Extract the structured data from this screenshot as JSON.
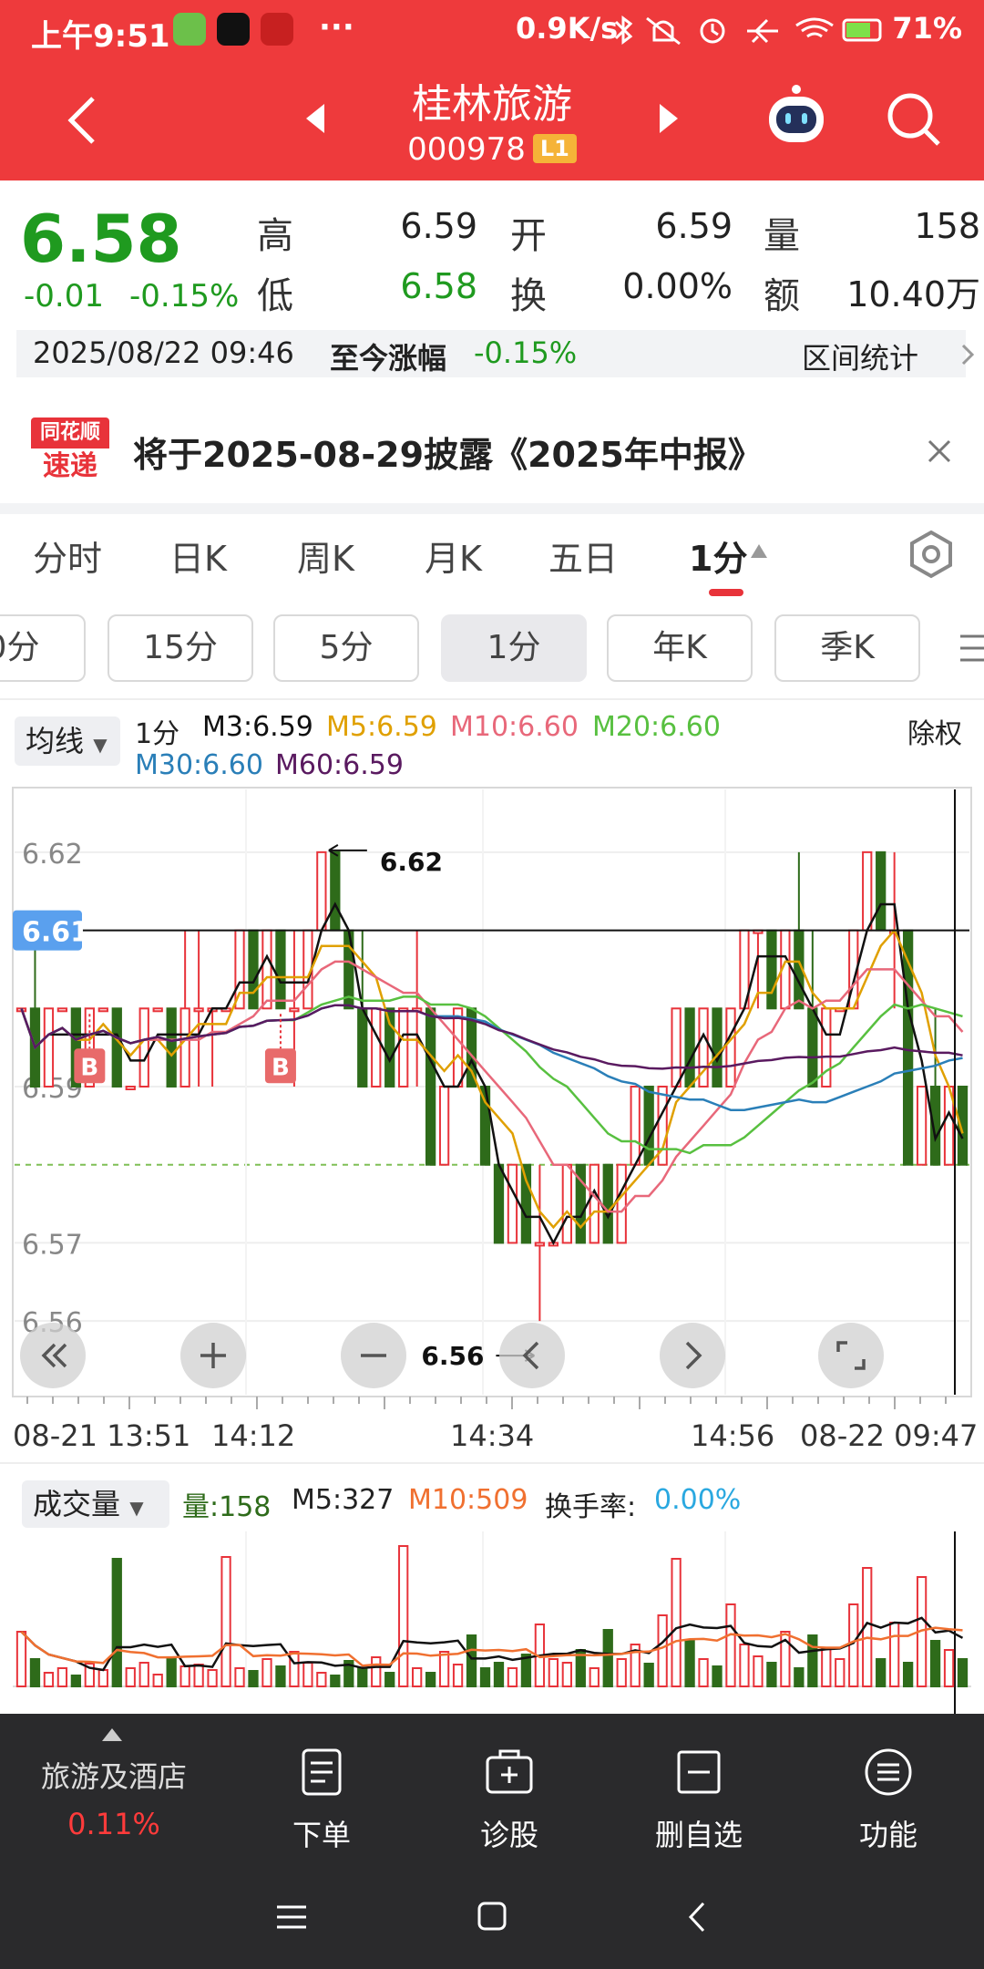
{
  "status": {
    "time": "上午9:51",
    "ellipsis": "···",
    "net_speed": "0.9K/s",
    "battery": "71%"
  },
  "nav": {
    "stock_name": "桂林旅游",
    "stock_code": "000978",
    "level_badge": "L1"
  },
  "quote": {
    "price": "6.58",
    "change": "-0.01",
    "change_pct": "-0.15%",
    "high_label": "高",
    "high": "6.59",
    "low_label": "低",
    "low": "6.58",
    "open_label": "开",
    "open": "6.59",
    "turnover_label": "换",
    "turnover": "0.00%",
    "volume_label": "量",
    "volume": "158",
    "amount_label": "额",
    "amount": "10.40万"
  },
  "datebar": {
    "datetime": "2025/08/22 09:46",
    "since_label": "至今涨幅",
    "since_value": "-0.15%",
    "interval_stats": "区间统计"
  },
  "notice": {
    "logo_top": "同花顺",
    "logo_bottom": "速递",
    "text": "将于2025-08-29披露《2025年中报》"
  },
  "period_tabs": [
    "分时",
    "日K",
    "周K",
    "月K",
    "五日",
    "1分"
  ],
  "period_pills": [
    "0分",
    "15分",
    "5分",
    "1分",
    "年K",
    "季K"
  ],
  "legend": {
    "ma_button": "均线",
    "period": "1分",
    "m3": "M3:6.59",
    "m5": "M5:6.59",
    "m10": "M10:6.60",
    "m20": "M20:6.60",
    "m30": "M30:6.60",
    "m60": "M60:6.59",
    "adjust": "除权"
  },
  "colors": {
    "header": "#ee3a3c",
    "up": "#e8333a",
    "down": "#2e6b1a",
    "m3": "#111111",
    "m5": "#e0a000",
    "m10": "#e8687a",
    "m20": "#58c040",
    "m30": "#2a7fb8",
    "m60": "#5a1a60"
  },
  "chart_data": {
    "type": "candlestick",
    "y_ticks": [
      "6.62",
      "6.61",
      "6.59",
      "6.57",
      "6.56"
    ],
    "ylim": [
      6.555,
      6.625
    ],
    "crosshair_value": "6.61",
    "max_label": "6.62",
    "min_label": "6.56",
    "buy_marker": "B",
    "x_ticks": [
      "08-21 13:51",
      "14:12",
      "14:34",
      "14:56",
      "08-22 09:47"
    ],
    "controls": [
      "first-icon",
      "plus-icon",
      "minus-icon",
      "prev-icon",
      "next-icon",
      "fullscreen-icon"
    ],
    "candles": [
      [
        6.6,
        6.6,
        6.6,
        6.6
      ],
      [
        6.6,
        6.61,
        6.59,
        6.59
      ],
      [
        6.59,
        6.6,
        6.59,
        6.6
      ],
      [
        6.6,
        6.6,
        6.6,
        6.6
      ],
      [
        6.6,
        6.6,
        6.59,
        6.59
      ],
      [
        6.59,
        6.6,
        6.59,
        6.6
      ],
      [
        6.6,
        6.6,
        6.6,
        6.6
      ],
      [
        6.6,
        6.6,
        6.59,
        6.59
      ],
      [
        6.59,
        6.59,
        6.59,
        6.59
      ],
      [
        6.59,
        6.6,
        6.59,
        6.6
      ],
      [
        6.6,
        6.6,
        6.6,
        6.6
      ],
      [
        6.6,
        6.6,
        6.59,
        6.59
      ],
      [
        6.59,
        6.61,
        6.59,
        6.6
      ],
      [
        6.6,
        6.61,
        6.59,
        6.6
      ],
      [
        6.6,
        6.6,
        6.59,
        6.6
      ],
      [
        6.6,
        6.6,
        6.6,
        6.6
      ],
      [
        6.6,
        6.61,
        6.6,
        6.61
      ],
      [
        6.61,
        6.61,
        6.6,
        6.6
      ],
      [
        6.6,
        6.61,
        6.6,
        6.61
      ],
      [
        6.61,
        6.61,
        6.6,
        6.6
      ],
      [
        6.6,
        6.61,
        6.59,
        6.6
      ],
      [
        6.6,
        6.61,
        6.6,
        6.61
      ],
      [
        6.61,
        6.62,
        6.61,
        6.62
      ],
      [
        6.62,
        6.62,
        6.61,
        6.61
      ],
      [
        6.61,
        6.61,
        6.6,
        6.6
      ],
      [
        6.6,
        6.61,
        6.59,
        6.59
      ],
      [
        6.59,
        6.6,
        6.59,
        6.6
      ],
      [
        6.6,
        6.6,
        6.59,
        6.59
      ],
      [
        6.59,
        6.6,
        6.59,
        6.6
      ],
      [
        6.6,
        6.61,
        6.59,
        6.6
      ],
      [
        6.6,
        6.6,
        6.58,
        6.58
      ],
      [
        6.58,
        6.59,
        6.58,
        6.59
      ],
      [
        6.59,
        6.6,
        6.59,
        6.6
      ],
      [
        6.6,
        6.6,
        6.59,
        6.59
      ],
      [
        6.59,
        6.59,
        6.58,
        6.58
      ],
      [
        6.58,
        6.58,
        6.57,
        6.57
      ],
      [
        6.57,
        6.58,
        6.57,
        6.58
      ],
      [
        6.58,
        6.58,
        6.57,
        6.57
      ],
      [
        6.57,
        6.58,
        6.56,
        6.57
      ],
      [
        6.57,
        6.57,
        6.57,
        6.57
      ],
      [
        6.57,
        6.58,
        6.57,
        6.58
      ],
      [
        6.58,
        6.58,
        6.57,
        6.57
      ],
      [
        6.57,
        6.58,
        6.57,
        6.58
      ],
      [
        6.58,
        6.58,
        6.57,
        6.57
      ],
      [
        6.57,
        6.58,
        6.57,
        6.58
      ],
      [
        6.58,
        6.59,
        6.58,
        6.59
      ],
      [
        6.59,
        6.59,
        6.58,
        6.58
      ],
      [
        6.58,
        6.59,
        6.58,
        6.59
      ],
      [
        6.59,
        6.6,
        6.59,
        6.6
      ],
      [
        6.6,
        6.6,
        6.59,
        6.59
      ],
      [
        6.59,
        6.6,
        6.59,
        6.6
      ],
      [
        6.6,
        6.6,
        6.59,
        6.59
      ],
      [
        6.59,
        6.6,
        6.59,
        6.6
      ],
      [
        6.6,
        6.61,
        6.6,
        6.61
      ],
      [
        6.61,
        6.61,
        6.6,
        6.61
      ],
      [
        6.61,
        6.61,
        6.6,
        6.6
      ],
      [
        6.6,
        6.61,
        6.6,
        6.61
      ],
      [
        6.61,
        6.62,
        6.6,
        6.6
      ],
      [
        6.6,
        6.61,
        6.59,
        6.59
      ],
      [
        6.59,
        6.6,
        6.59,
        6.6
      ],
      [
        6.6,
        6.6,
        6.6,
        6.6
      ],
      [
        6.6,
        6.61,
        6.6,
        6.61
      ],
      [
        6.61,
        6.62,
        6.61,
        6.62
      ],
      [
        6.62,
        6.62,
        6.61,
        6.61
      ],
      [
        6.61,
        6.62,
        6.6,
        6.61
      ],
      [
        6.61,
        6.61,
        6.58,
        6.58
      ],
      [
        6.58,
        6.59,
        6.58,
        6.59
      ],
      [
        6.59,
        6.6,
        6.58,
        6.58
      ],
      [
        6.58,
        6.59,
        6.58,
        6.59
      ],
      [
        6.59,
        6.59,
        6.58,
        6.58
      ]
    ],
    "volume": {
      "label": "成交量",
      "vol_text": "量:158",
      "m5_text": "M5:327",
      "m10_text": "M10:509",
      "turnover_label": "换手率:",
      "turnover_value": "0.00%",
      "values": [
        600,
        300,
        150,
        200,
        120,
        250,
        180,
        1400,
        200,
        260,
        130,
        300,
        220,
        240,
        180,
        1420,
        200,
        170,
        300,
        220,
        380,
        260,
        150,
        120,
        280,
        200,
        320,
        150,
        1540,
        200,
        150,
        380,
        240,
        560,
        200,
        260,
        200,
        350,
        680,
        300,
        260,
        400,
        200,
        620,
        300,
        460,
        250,
        780,
        1400,
        500,
        300,
        220,
        900,
        460,
        330,
        260,
        600,
        200,
        560,
        420,
        300,
        900,
        1300,
        300,
        700,
        260,
        1200,
        500,
        400,
        300
      ]
    }
  },
  "bottom": {
    "sector_name": "旅游及酒店",
    "sector_change": "0.11%",
    "order": "下单",
    "diagnose": "诊股",
    "remove_watch": "删自选",
    "functions": "功能"
  }
}
